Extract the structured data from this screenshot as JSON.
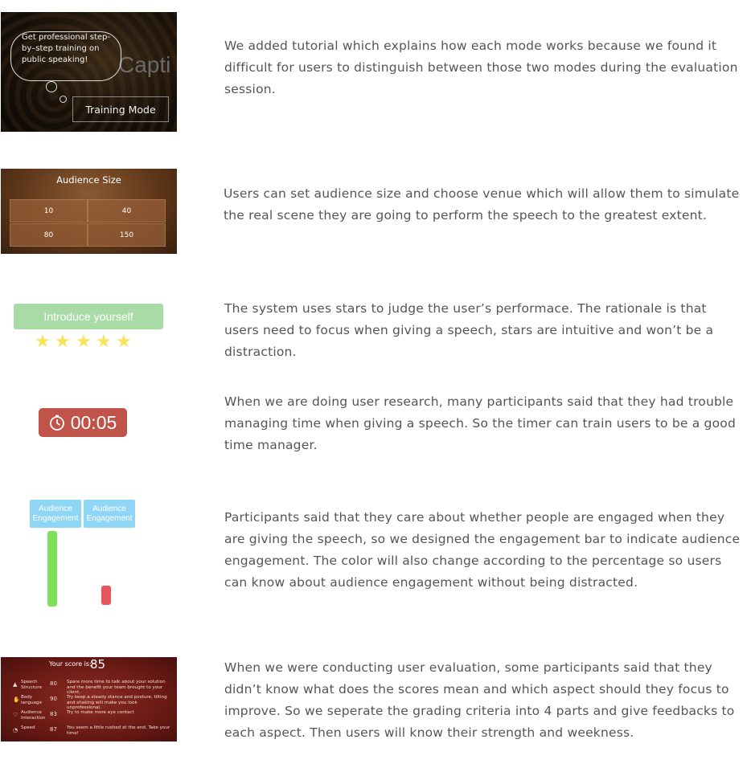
{
  "sections": [
    {
      "id": "tutorial",
      "description": "We added tutorial which explains how each mode works because we found it difficult for users to distinguish between those two modes during the evaluation session.",
      "bubble_text": "Get professional step-by–step training on public speaking!",
      "background_word": "Capti",
      "mode_button": "Training Mode"
    },
    {
      "id": "audience",
      "description": "Users can set audience size and choose venue which will allow them to simulate the real scene they are going to perform the speech to the greatest extent.",
      "title": "Audience Size",
      "options": [
        "10",
        "40",
        "80",
        "150"
      ]
    },
    {
      "id": "stars",
      "description": "The system uses stars to judge the user’s performace. The rationale is that users need to focus when giving a speech, stars are intuitive and won’t be a distraction.",
      "label": "Introduce yourself",
      "rating": 5
    },
    {
      "id": "timer",
      "description": "When we are doing user research, many participants said that they had trouble managing time when giving a speech. So the timer can train users to be a good time manager.",
      "time": "00:05"
    },
    {
      "id": "engagement",
      "description": "Participants said that they care about whether people are engaged when they are giving the speech, so we designed the engagement bar to indicate audience engagement. The color will also change according to the percentage so users can know about audience engagement without being distracted.",
      "bars": [
        {
          "label": "Audience Engagement",
          "level": 1.0,
          "color": "#7ee05a"
        },
        {
          "label": "Audience Engagement",
          "level": 0.25,
          "color": "#e8555f"
        }
      ]
    },
    {
      "id": "score",
      "description": "When we were conducting user evaluation, some participants said that they didn’t know what does the scores mean and which aspect should they focus to improve. So we seperate the grading criteria into 4 parts and give feedbacks to each aspect. Then users will know their strength and weekness.",
      "score_label": "Your score is:",
      "score": "85",
      "rows": [
        {
          "category": "Speech Structure",
          "value": "80",
          "feedback": "Spare more time to talk about your solution and the benefit your team brought to your client."
        },
        {
          "category": "Body language",
          "value": "90",
          "feedback": "Try keep a steady stance and posture, tilting and shaking will make you look unprofessional."
        },
        {
          "category": "Audience Interaction",
          "value": "83",
          "feedback": "Try to make more eye contact"
        },
        {
          "category": "Speed",
          "value": "87",
          "feedback": "You seem a little rushed at the end. Take your time!"
        }
      ]
    }
  ]
}
